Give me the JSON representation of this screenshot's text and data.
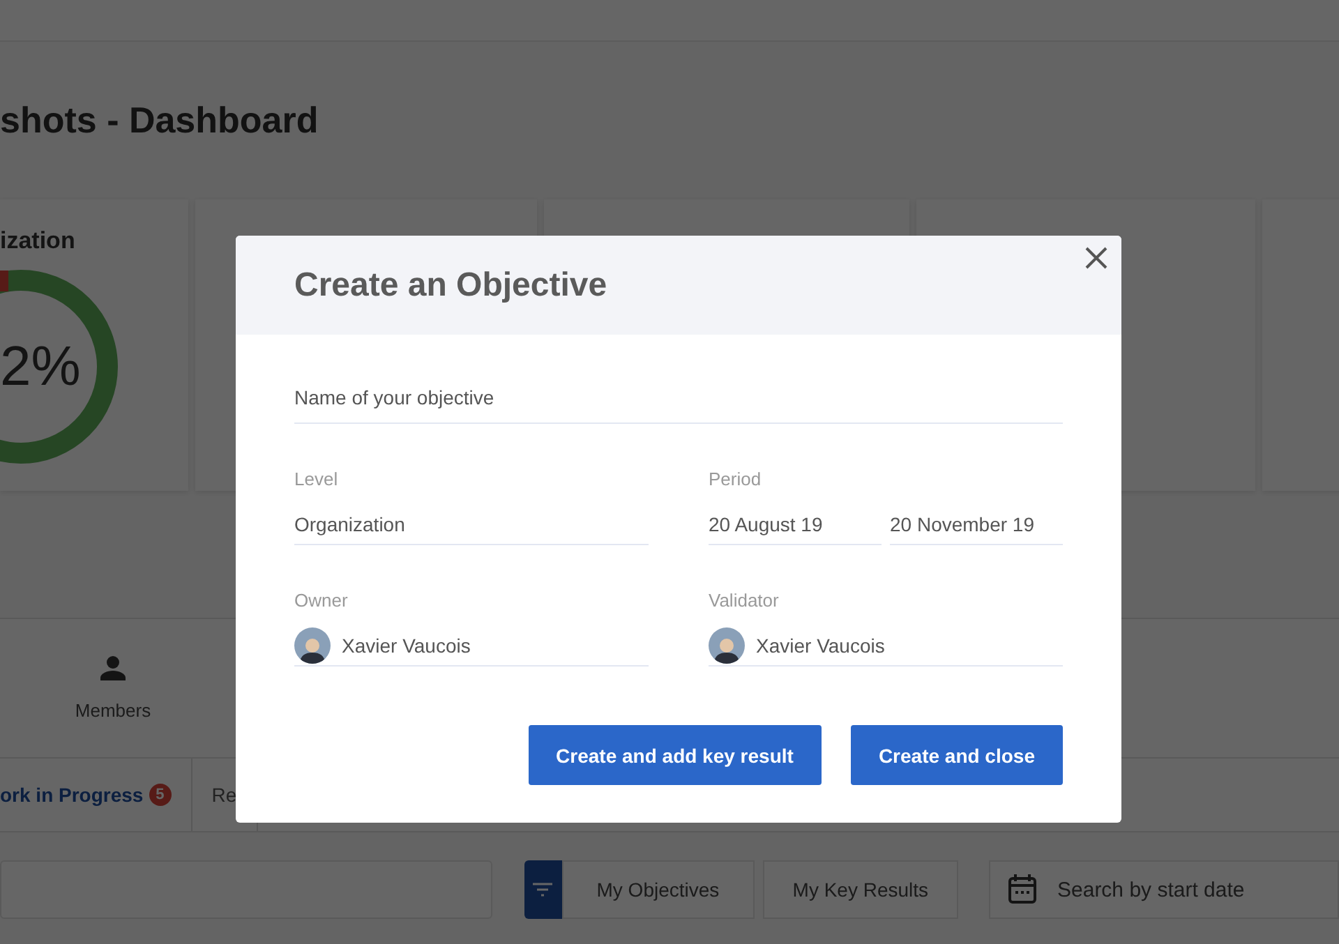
{
  "dashboard": {
    "title": "shots - Dashboard",
    "summary_card": {
      "title": "ization",
      "value": "2%"
    }
  },
  "nav": {
    "items": [
      {
        "label": "Members"
      }
    ]
  },
  "tabs": [
    {
      "label": "ork in Progress",
      "badge": "5",
      "selected": true
    },
    {
      "label": "Re",
      "selected": false
    }
  ],
  "filters": {
    "buttons": [
      {
        "label": "My Objectives",
        "selected": false
      },
      {
        "label": "My Key Results",
        "selected": false
      }
    ],
    "date_search": {
      "placeholder": "Search by start date"
    }
  },
  "modal": {
    "title": "Create an Objective",
    "name_field": {
      "placeholder": "Name of your objective"
    },
    "level": {
      "label": "Level",
      "value": "Organization"
    },
    "period": {
      "label": "Period",
      "start": "20 August 19",
      "end": "20 November 19"
    },
    "owner": {
      "label": "Owner",
      "name": "Xavier Vaucois"
    },
    "validator": {
      "label": "Validator",
      "name": "Xavier Vaucois"
    },
    "buttons": [
      "Create and add key result",
      "Create and close"
    ]
  }
}
